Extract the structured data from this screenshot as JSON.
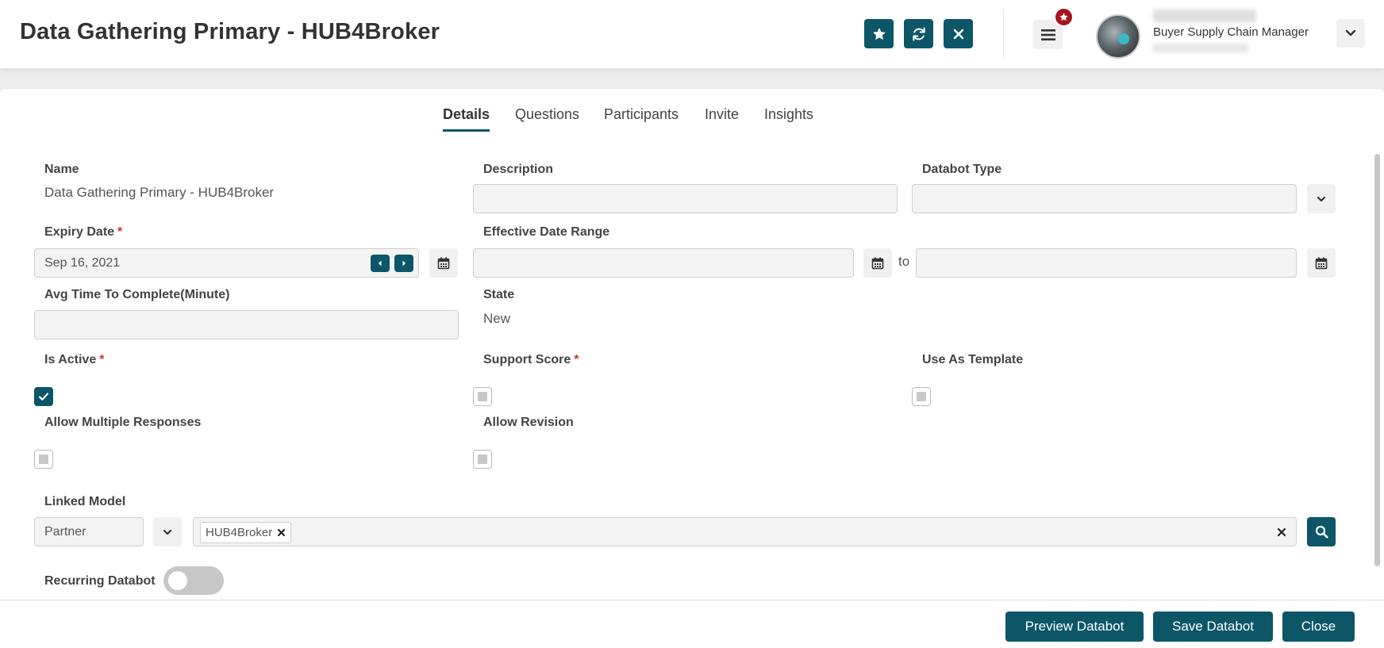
{
  "header": {
    "title": "Data Gathering Primary - HUB4Broker",
    "user_role": "Buyer Supply Chain Manager",
    "actions": [
      "star-icon",
      "refresh-icon",
      "close-icon"
    ]
  },
  "tabs": [
    {
      "label": "Details",
      "active": true
    },
    {
      "label": "Questions",
      "active": false
    },
    {
      "label": "Participants",
      "active": false
    },
    {
      "label": "Invite",
      "active": false
    },
    {
      "label": "Insights",
      "active": false
    }
  ],
  "form": {
    "name": {
      "label": "Name",
      "value": "Data Gathering Primary - HUB4Broker"
    },
    "description": {
      "label": "Description",
      "value": ""
    },
    "databot_type": {
      "label": "Databot Type",
      "value": ""
    },
    "expiry_date": {
      "label": "Expiry Date",
      "required": "*",
      "value": "Sep 16, 2021"
    },
    "effective_date_range": {
      "label": "Effective Date Range",
      "from": "",
      "separator": "to",
      "to": ""
    },
    "avg_time": {
      "label": "Avg Time To Complete(Minute)",
      "value": ""
    },
    "state": {
      "label": "State",
      "value": "New"
    },
    "is_active": {
      "label": "Is Active",
      "required": "*",
      "checked": true
    },
    "support_score": {
      "label": "Support Score",
      "required": "*",
      "checked": false
    },
    "use_as_template": {
      "label": "Use As Template",
      "checked": false
    },
    "allow_multiple_responses": {
      "label": "Allow Multiple Responses",
      "checked": false
    },
    "allow_revision": {
      "label": "Allow Revision",
      "checked": false
    },
    "linked_model": {
      "label": "Linked Model",
      "type_value": "Partner",
      "chip": "HUB4Broker"
    },
    "recurring_databot": {
      "label": "Recurring Databot",
      "on": false
    }
  },
  "footer": {
    "preview": "Preview Databot",
    "save": "Save Databot",
    "close": "Close"
  },
  "colors": {
    "accent": "#0c5668",
    "badge": "#a3161e",
    "required": "#c0392b"
  }
}
